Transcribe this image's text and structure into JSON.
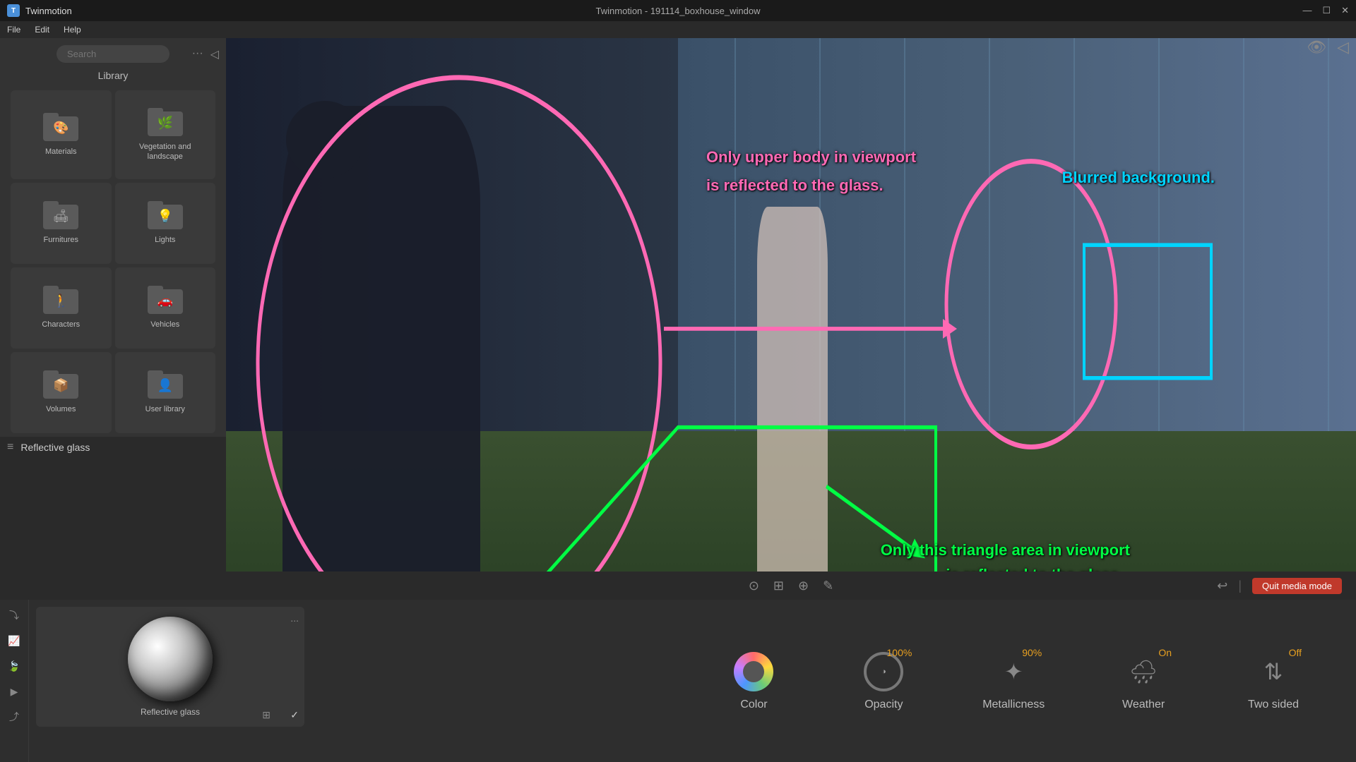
{
  "window": {
    "title": "Twinmotion - 191114_boxhouse_window",
    "appname": "Twinmotion",
    "min_label": "—",
    "max_label": "☐",
    "close_label": "✕",
    "fullscreen_label": "⤢"
  },
  "menubar": {
    "file": "File",
    "edit": "Edit",
    "help": "Help"
  },
  "sidebar": {
    "search_placeholder": "Search",
    "library_label": "Library",
    "items": [
      {
        "label": "Materials",
        "icon": "fan-icon"
      },
      {
        "label": "Vegetation and landscape",
        "icon": "tree-icon"
      },
      {
        "label": "Furnitures",
        "icon": "sofa-icon"
      },
      {
        "label": "Lights",
        "icon": "bulb-icon"
      },
      {
        "label": "Characters",
        "icon": "person-icon"
      },
      {
        "label": "Vehicles",
        "icon": "car-icon"
      },
      {
        "label": "Volumes",
        "icon": "box-icon"
      },
      {
        "label": "User library",
        "icon": "user-icon"
      }
    ]
  },
  "panel_label": {
    "menu_icon": "≡",
    "text": "Reflective glass"
  },
  "material_card": {
    "three_dots": "...",
    "label": "Reflective glass",
    "checkmark": "✓"
  },
  "props": {
    "color": {
      "label": "Color",
      "value": ""
    },
    "opacity": {
      "label": "Opacity",
      "value": "100%"
    },
    "metallicness": {
      "label": "Metallicness",
      "value": "90%"
    },
    "weather": {
      "label": "Weather",
      "value": "On"
    },
    "two_sided": {
      "label": "Two sided",
      "value": "Off"
    }
  },
  "annotations": {
    "pink_top": "Only upper body in viewport",
    "pink_top2": "is reflected to the glass.",
    "green_bottom": "Only this triangle area in viewport",
    "green_bottom2": "is reflected to the glass.",
    "cyan": "Blurred background."
  },
  "viewport_toolbar": {
    "quit_media_label": "Quit media mode",
    "icons": [
      "⊙",
      "⊞",
      "⊕",
      "✎"
    ]
  }
}
